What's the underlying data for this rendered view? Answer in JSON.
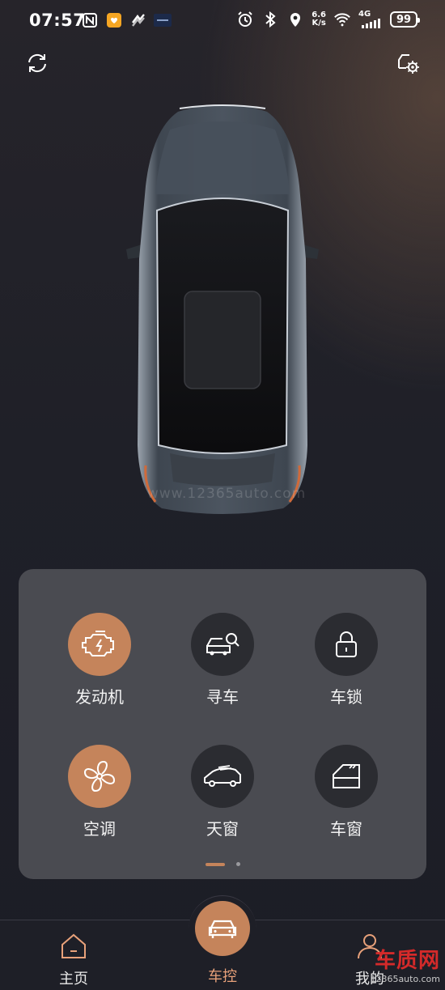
{
  "status_bar": {
    "time": "07:57",
    "net_speed_value": "6.6",
    "net_speed_unit": "K/s",
    "network": "4G",
    "battery": "99"
  },
  "watermark": "www.12365auto.com",
  "controls": [
    {
      "label": "发动机",
      "icon": "engine-icon",
      "active": true
    },
    {
      "label": "寻车",
      "icon": "find-car-icon",
      "active": false
    },
    {
      "label": "车锁",
      "icon": "lock-icon",
      "active": false
    },
    {
      "label": "空调",
      "icon": "fan-icon",
      "active": true
    },
    {
      "label": "天窗",
      "icon": "sunroof-icon",
      "active": false
    },
    {
      "label": "车窗",
      "icon": "window-icon",
      "active": false
    }
  ],
  "nav": {
    "home": "主页",
    "control": "车控",
    "me": "我的"
  },
  "corner_watermark": {
    "brand": "车质网",
    "site": "12365auto.com"
  },
  "colors": {
    "accent": "#c5845b",
    "panel": "#4a4b51",
    "background": "#1f2028"
  }
}
